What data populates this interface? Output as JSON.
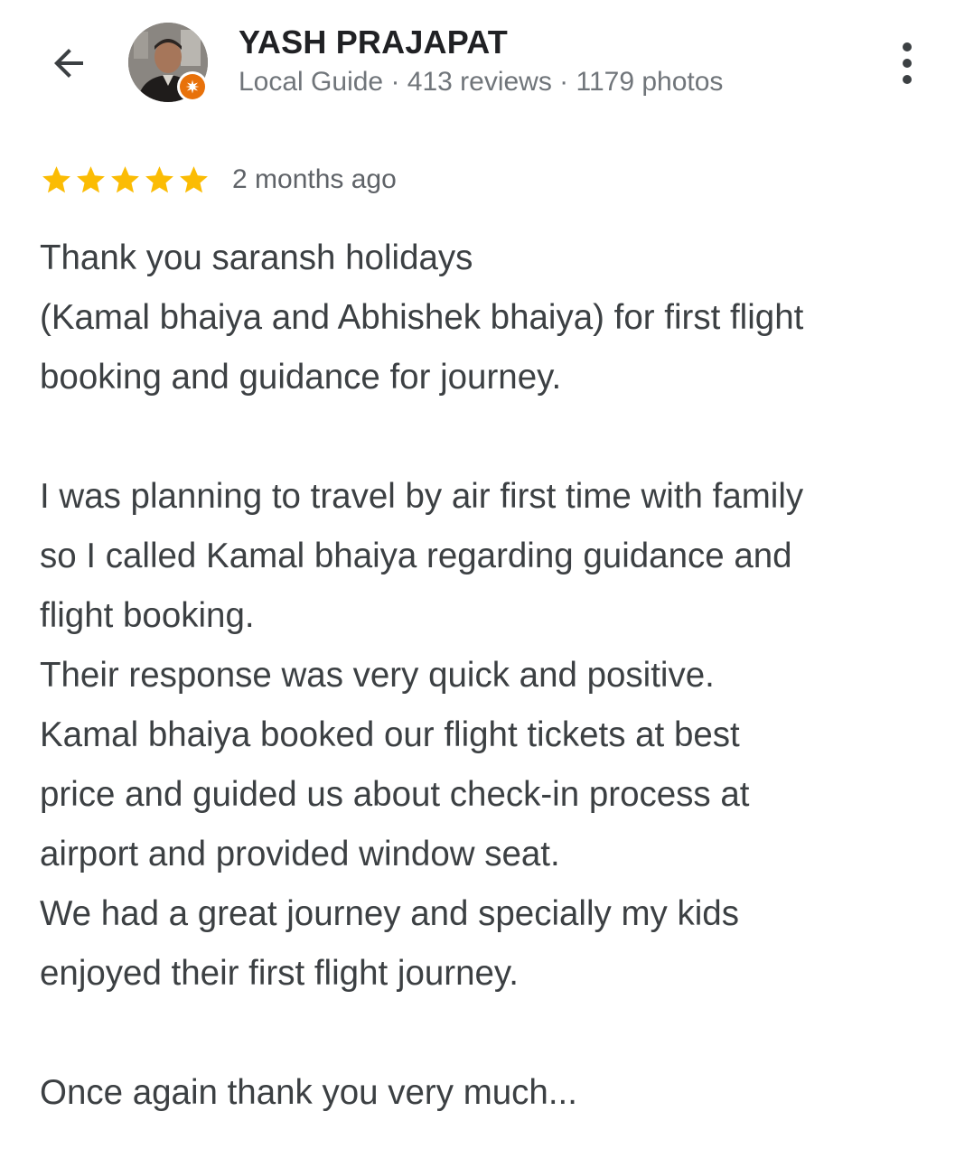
{
  "header": {
    "back_icon": "arrow-left-icon",
    "user_name": "YASH PRAJAPAT",
    "user_meta": "Local Guide · 413 reviews · 1179 photos",
    "avatar_badge_icon": "local-guide-badge-icon",
    "more_icon": "more-vert-icon",
    "badge_color": "#e8710a"
  },
  "review": {
    "rating": 5,
    "rating_max": 5,
    "star_color": "#fbbc04",
    "date": "2 months ago",
    "paragraph_1": [
      "Thank you saransh holidays",
      "(Kamal bhaiya and Abhishek bhaiya) for first flight",
      "booking and guidance for journey."
    ],
    "paragraph_2": [
      "I was planning to travel by air first time with family",
      "so I called Kamal bhaiya regarding guidance and",
      "flight booking.",
      "Their response was very quick and positive.",
      "Kamal bhaiya booked our flight tickets at best",
      "price and guided us about check-in process at",
      "airport and provided window seat.",
      "We had a great journey and specially my kids",
      "enjoyed their first flight journey."
    ],
    "paragraph_3": [
      "Once again thank you very much..."
    ]
  }
}
